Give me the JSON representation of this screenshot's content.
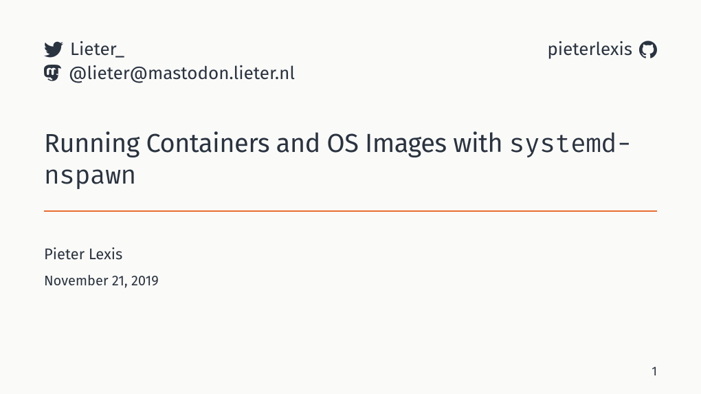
{
  "social": {
    "twitter_handle": "Lieter_",
    "github_handle": "pieterlexis",
    "mastodon_handle": "@lieter@mastodon.lieter.nl"
  },
  "title": {
    "prefix": "Running Containers and OS Images with ",
    "code": "systemd-nspawn"
  },
  "author": "Pieter Lexis",
  "date": "November 21, 2019",
  "page_number": "1",
  "colors": {
    "text": "#2a3340",
    "rule": "#e86d2f",
    "bg": "#fafaf8"
  }
}
